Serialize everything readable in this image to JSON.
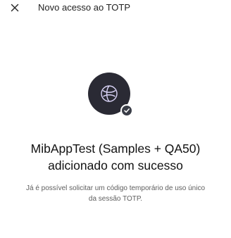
{
  "header": {
    "title": "Novo acesso ao TOTP",
    "close_icon": "close-icon"
  },
  "hero": {
    "icon": "globe-icon",
    "badge_icon": "check-icon",
    "circle_color": "#2a2a34",
    "badge_color": "#3a3d47"
  },
  "content": {
    "title_line1": "MibAppTest (Samples + QA50)",
    "title_line2": "adicionado com sucesso",
    "description_line1": "Já é possível solicitar um código temporário de uso único",
    "description_line2": "da sessão TOTP."
  }
}
